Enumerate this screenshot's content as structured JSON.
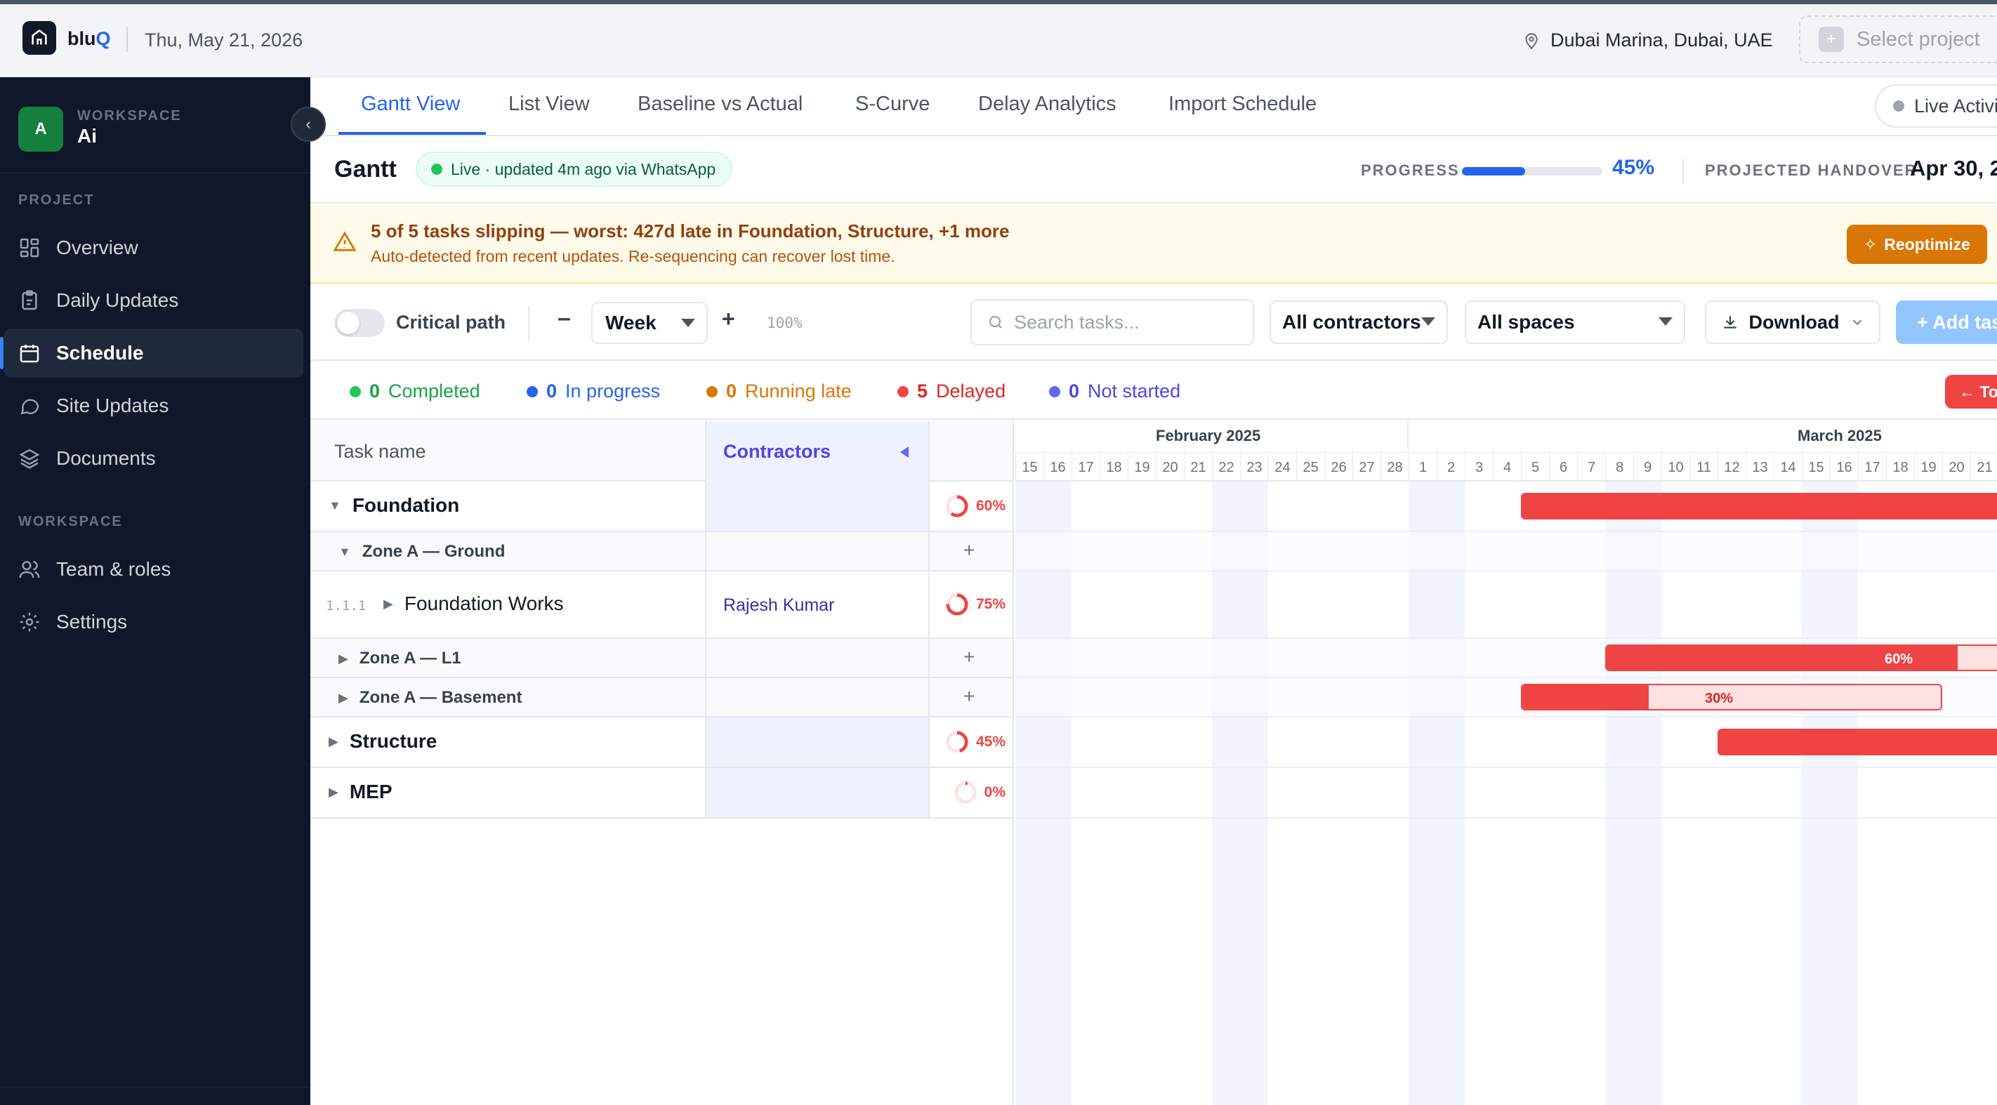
{
  "app": {
    "logo": "blu",
    "logo_q": "Q",
    "date": "Thu, May 21, 2026",
    "location": "Dubai Marina, Dubai, UAE",
    "select_project": "Select project"
  },
  "sidebar": {
    "workspace_label": "WORKSPACE",
    "workspace_name": "Ai",
    "avatar_letter": "A",
    "section_project": "PROJECT",
    "section_workspace": "WORKSPACE",
    "items": [
      {
        "label": "Overview",
        "icon": "grid-icon"
      },
      {
        "label": "Daily Updates",
        "icon": "clipboard-icon"
      },
      {
        "label": "Schedule",
        "icon": "calendar-icon",
        "active": true
      },
      {
        "label": "Site Updates",
        "icon": "chat-icon"
      },
      {
        "label": "Documents",
        "icon": "layers-icon"
      },
      {
        "label": "Team & roles",
        "icon": "users-icon"
      },
      {
        "label": "Settings",
        "icon": "gear-icon"
      }
    ]
  },
  "tabs": [
    {
      "label": "Gantt View",
      "active": true
    },
    {
      "label": "List View"
    },
    {
      "label": "Baseline vs Actual"
    },
    {
      "label": "S-Curve"
    },
    {
      "label": "Delay Analytics"
    },
    {
      "label": "Import Schedule"
    }
  ],
  "live_activity": "Live Activi",
  "gantt": {
    "title": "Gantt",
    "live_status": "Live · updated 4m ago via WhatsApp",
    "progress_label": "PROGRESS",
    "progress_value": 0.45,
    "progress_text": "45%",
    "handover_label": "PROJECTED HANDOVER",
    "handover_value": "Apr 30, 2"
  },
  "alert": {
    "title": "5 of 5 tasks slipping — worst: 427d late in Foundation, Structure, +1 more",
    "subtitle": "Auto-detected from recent updates. Re-sequencing can recover lost time.",
    "button": "Reoptimize"
  },
  "toolbar": {
    "critical_path": "Critical path",
    "minus": "–",
    "scale": "Week",
    "plus": "+",
    "zoom": "100%",
    "search_placeholder": "Search tasks...",
    "contractors": "All contractors",
    "spaces": "All spaces",
    "download": "Download",
    "add_task": "+ Add tas"
  },
  "legend": [
    {
      "count": "0",
      "label": "Completed",
      "color": "#22c55e",
      "text_color": "#16a34a"
    },
    {
      "count": "0",
      "label": "In progress",
      "color": "#2563eb",
      "text_color": "#2563eb"
    },
    {
      "count": "0",
      "label": "Running late",
      "color": "#d97706",
      "text_color": "#d97706"
    },
    {
      "count": "5",
      "label": "Delayed",
      "color": "#ef4444",
      "text_color": "#dc2626"
    },
    {
      "count": "0",
      "label": "Not started",
      "color": "#6366f1",
      "text_color": "#4f46e5"
    }
  ],
  "today_button": "← Tod",
  "table": {
    "task_header": "Task name",
    "contractors_header": "Contractors",
    "rows": [
      {
        "name": "Foundation",
        "level": 0,
        "expanded": true,
        "pct": "60%"
      },
      {
        "name": "Zone A — Ground",
        "level": 1,
        "expanded": true,
        "plus": "+"
      },
      {
        "name": "Foundation Works",
        "level": 2,
        "wbs": "1.1.1",
        "contractor": "Rajesh Kumar",
        "pct": "75%"
      },
      {
        "name": "Zone A — L1",
        "level": 1,
        "plus": "+"
      },
      {
        "name": "Zone A — Basement",
        "level": 1,
        "plus": "+"
      },
      {
        "name": "Structure",
        "level": 0,
        "pct": "45%"
      },
      {
        "name": "MEP",
        "level": 0,
        "pct": "0%"
      }
    ]
  },
  "timeline": {
    "months": [
      "February 2025",
      "March 2025"
    ],
    "feb_days": [
      "15",
      "16",
      "17",
      "18",
      "19",
      "20",
      "21",
      "22",
      "23",
      "24",
      "25",
      "26",
      "27",
      "28"
    ],
    "mar_days": [
      "1",
      "2",
      "3",
      "4",
      "5",
      "6",
      "7",
      "8",
      "9",
      "10",
      "11",
      "12",
      "13",
      "14",
      "15",
      "16",
      "17",
      "18",
      "19",
      "20",
      "21"
    ],
    "bar_labels": {
      "l1": "60%",
      "basement": "30%"
    }
  },
  "colors": {
    "accent": "#2563eb",
    "delayed": "#ef4444",
    "warning": "#d97706",
    "sidebar_bg": "#0f172a"
  }
}
